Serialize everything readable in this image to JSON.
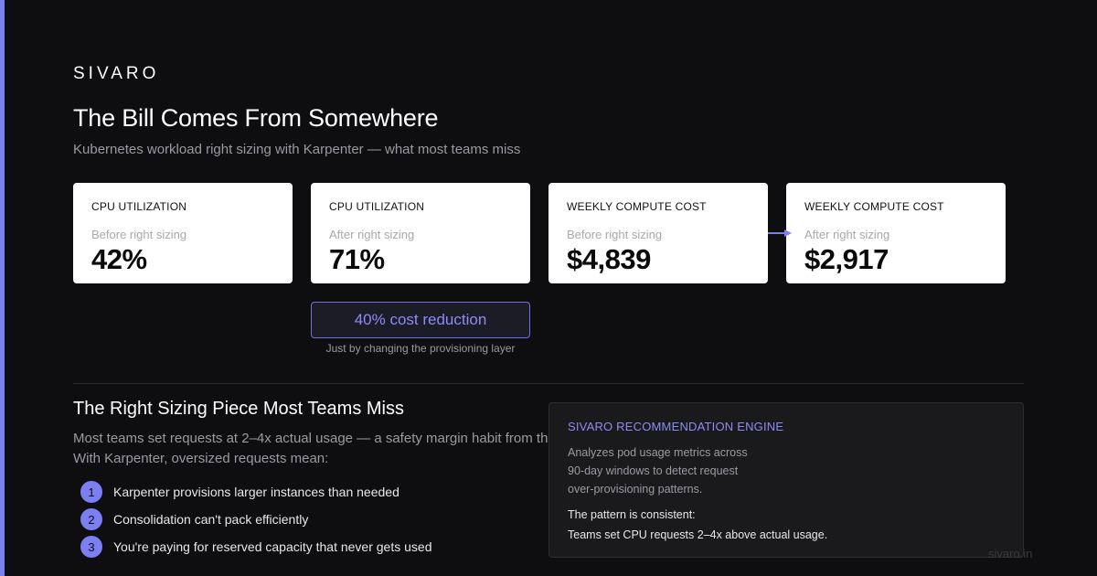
{
  "brand": "SIVARO",
  "title": "The Bill Comes From Somewhere",
  "subtitle": "Kubernetes workload right sizing with Karpenter — what most teams miss",
  "metrics": [
    {
      "label": "CPU UTILIZATION",
      "sub": "Before right sizing",
      "value": "42%"
    },
    {
      "label": "CPU UTILIZATION",
      "sub": "After right sizing",
      "value": "71%"
    },
    {
      "label": "WEEKLY COMPUTE COST",
      "sub": "Before right sizing",
      "value": "$4,839"
    },
    {
      "label": "WEEKLY COMPUTE COST",
      "sub": "After right sizing",
      "value": "$2,917"
    }
  ],
  "reduction": {
    "label": "40% cost reduction",
    "note": "Just by changing the provisioning layer"
  },
  "section": {
    "title": "The Right Sizing Piece Most Teams Miss",
    "body_line1": "Most teams set requests at 2–4x actual usage — a safety margin habit from th",
    "body_line2": "With Karpenter, oversized requests mean:",
    "bullets": [
      {
        "num": "1",
        "text": "Karpenter provisions larger instances than needed"
      },
      {
        "num": "2",
        "text": "Consolidation can't pack efficiently"
      },
      {
        "num": "3",
        "text": "You're paying for reserved capacity that never gets used"
      }
    ]
  },
  "engine": {
    "title": "SIVARO RECOMMENDATION ENGINE",
    "desc_lines": [
      "Analyzes pod usage metrics across",
      "90-day windows to detect request",
      "over-provisioning patterns."
    ],
    "pattern_label": "The pattern is consistent:",
    "pattern": "Teams set CPU requests 2–4x above actual usage."
  },
  "footer": {
    "url": "sivaro.in"
  },
  "colors": {
    "accent": "#7c7ff2",
    "background": "#0e0e10",
    "card": "#ffffff",
    "muted_text": "#9a9aa2"
  }
}
